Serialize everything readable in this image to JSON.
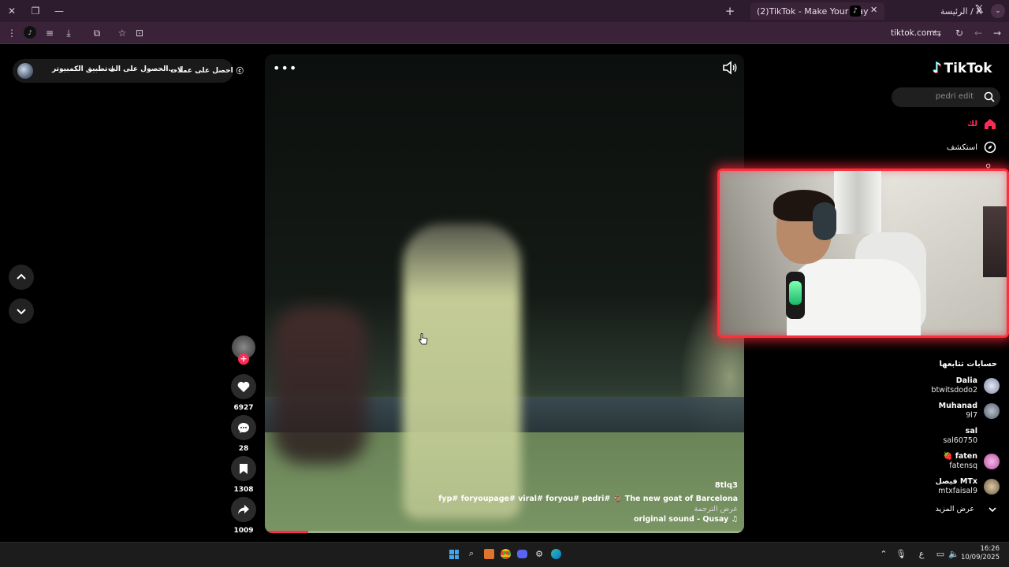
{
  "browser": {
    "tabs": [
      {
        "title": "الرئيسة / X",
        "active": false
      },
      {
        "title": "(2)TikTok - Make Your Day",
        "active": true
      }
    ],
    "url": "tiktok.com"
  },
  "top_pill": {
    "get_coins": "احصل على عملات",
    "get_app": "الحصول على الت...",
    "pc_app": "تطبيق الكمبيوتر"
  },
  "video": {
    "username": "8tlq3",
    "caption": "fyp# foryoupage# viral# foryou# pedri# 🐐 The new goat of Barcelona",
    "see_translation": "عرض الترجمة",
    "sound": "original sound - Qusay ♫",
    "progress": 0.09
  },
  "actions": {
    "likes": "6927",
    "comments": "28",
    "saves": "1308",
    "shares": "1009"
  },
  "sidebar": {
    "logo": "TikTok",
    "search_placeholder": "pedri edit",
    "nav": [
      {
        "label": "لك",
        "icon": "home-icon"
      },
      {
        "label": "استكشف",
        "icon": "compass-icon"
      }
    ],
    "following_title": "حسابات تتابعها",
    "accounts": [
      {
        "display": "Dalia",
        "username": "btwitsdodo2"
      },
      {
        "display": "Muhanad",
        "username": "9l7"
      },
      {
        "display": "sal",
        "username": "sal60750"
      },
      {
        "display": "🍓 faten",
        "username": "fatensq"
      },
      {
        "display": "فيصل MTx",
        "username": "mtxfaisal9"
      }
    ],
    "see_more": "عرض المزيد"
  },
  "taskbar": {
    "lang": "ع",
    "time": "16:26",
    "date": "10/09/2025"
  },
  "colors": {
    "accent": "#fe2c55",
    "webcam_border": "#ff2f3c",
    "tabbar": "#2d1b2e"
  }
}
